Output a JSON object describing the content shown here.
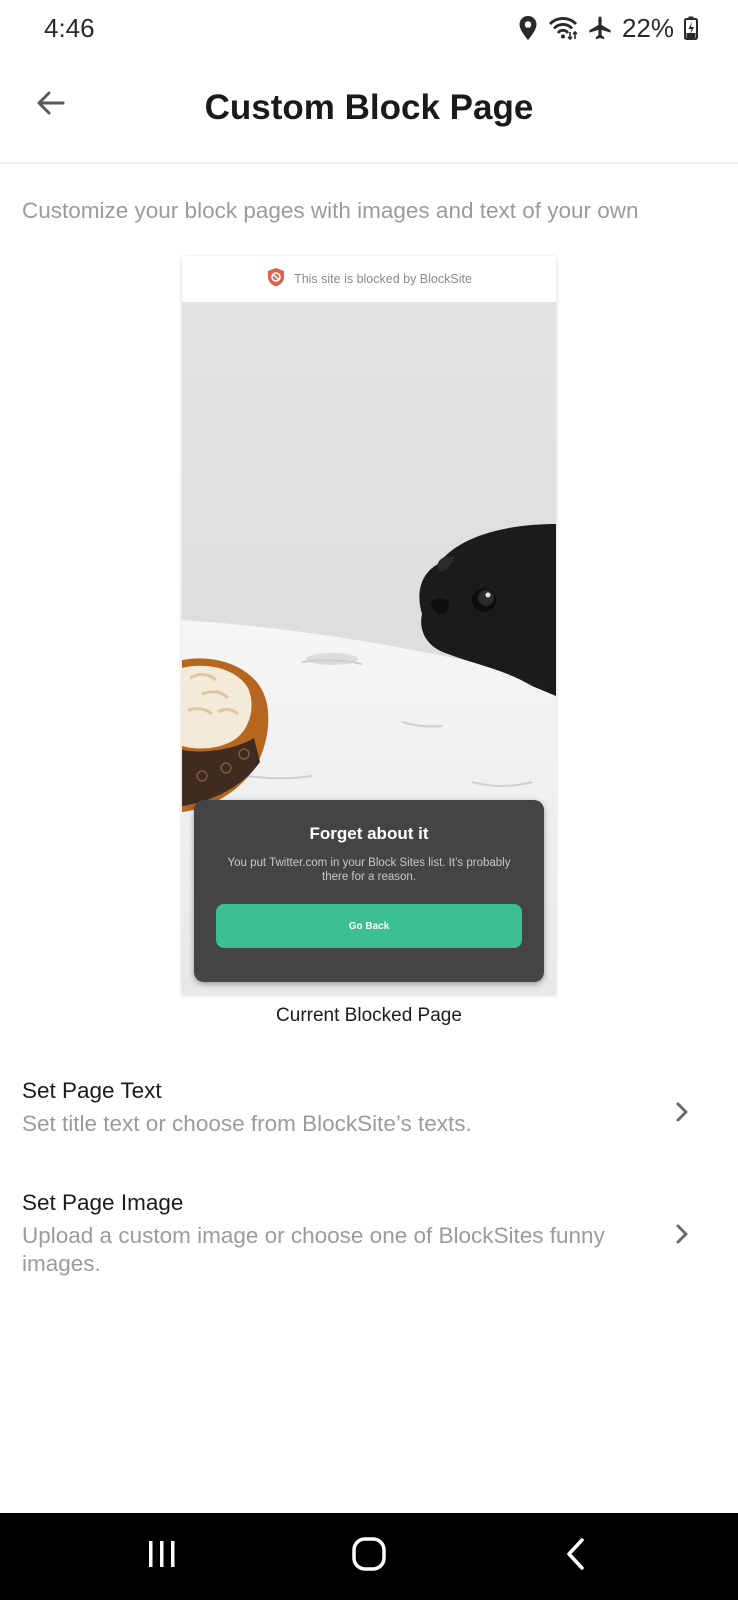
{
  "status_bar": {
    "time": "4:46",
    "battery": "22%",
    "icons": [
      "location-icon",
      "wifi-icon",
      "airplane-icon",
      "battery-icon"
    ]
  },
  "app_bar": {
    "title": "Custom Block Page",
    "back_icon": "arrow-left-icon"
  },
  "description": "Customize your block pages with images and text of your own",
  "preview": {
    "header_text": "This site is blocked by BlockSite",
    "header_icon": "shield-block-icon",
    "card_title": "Forget about it",
    "card_body": "You put Twitter.com in your Block Sites list. It’s probably there for a reason.",
    "button_label": "Go Back",
    "caption": "Current Blocked Page"
  },
  "settings": [
    {
      "title": "Set Page Text",
      "subtitle": "Set title text or choose from BlockSite’s texts."
    },
    {
      "title": "Set Page Image",
      "subtitle": "Upload a custom image or choose one of BlockSites funny images."
    }
  ],
  "colors": {
    "accent": "#3cbf92",
    "shield": "#d9644a",
    "overlay": "#444444"
  },
  "nav_bar": {
    "buttons": [
      "recent-apps-icon",
      "home-icon",
      "back-icon"
    ]
  }
}
